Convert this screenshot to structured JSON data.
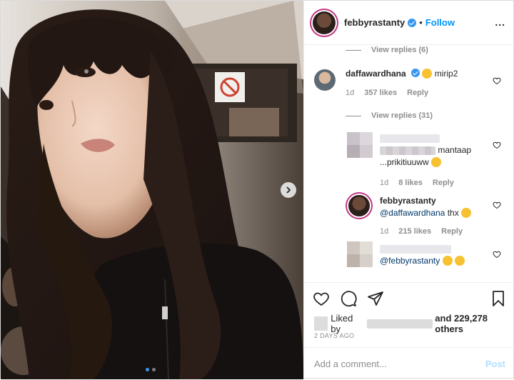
{
  "post_header": {
    "username": "febbyrastanty",
    "follow_label": "Follow",
    "separator": "•"
  },
  "comments": {
    "view_replies_top": "View replies (6)",
    "c1": {
      "username": "daffawardhana",
      "text": "mirip2",
      "age": "1d",
      "likes": "357 likes",
      "reply_label": "Reply"
    },
    "view_replies_mid": "View replies (31)",
    "c2": {
      "text_a": "mantaap",
      "text_b": "...prikitiuuww",
      "age": "1d",
      "likes": "8 likes",
      "reply_label": "Reply"
    },
    "c3": {
      "username": "febbyrastanty",
      "mention": "@daffawardhana",
      "text": "thx",
      "age": "1d",
      "likes": "215 likes",
      "reply_label": "Reply"
    },
    "c4": {
      "mention": "@febbyrastanty"
    }
  },
  "actions": {
    "liked_by_label": "Liked by",
    "and_others": "and 229,278 others",
    "date": "2 DAYS AGO"
  },
  "add_comment": {
    "placeholder": "Add a comment...",
    "post_label": "Post"
  },
  "carousel": {
    "current_slide": 1,
    "total_slides": 2
  },
  "icons": {
    "verified": "verified-badge-icon",
    "more": "more-options-icon",
    "heart": "heart-icon",
    "comment": "comment-icon",
    "share": "share-icon",
    "bookmark": "bookmark-icon",
    "next": "chevron-right-icon"
  },
  "colors": {
    "accent": "#0095f6",
    "muted": "#8e8e8e",
    "mention": "#00376b",
    "story_ring": "#c13584"
  }
}
